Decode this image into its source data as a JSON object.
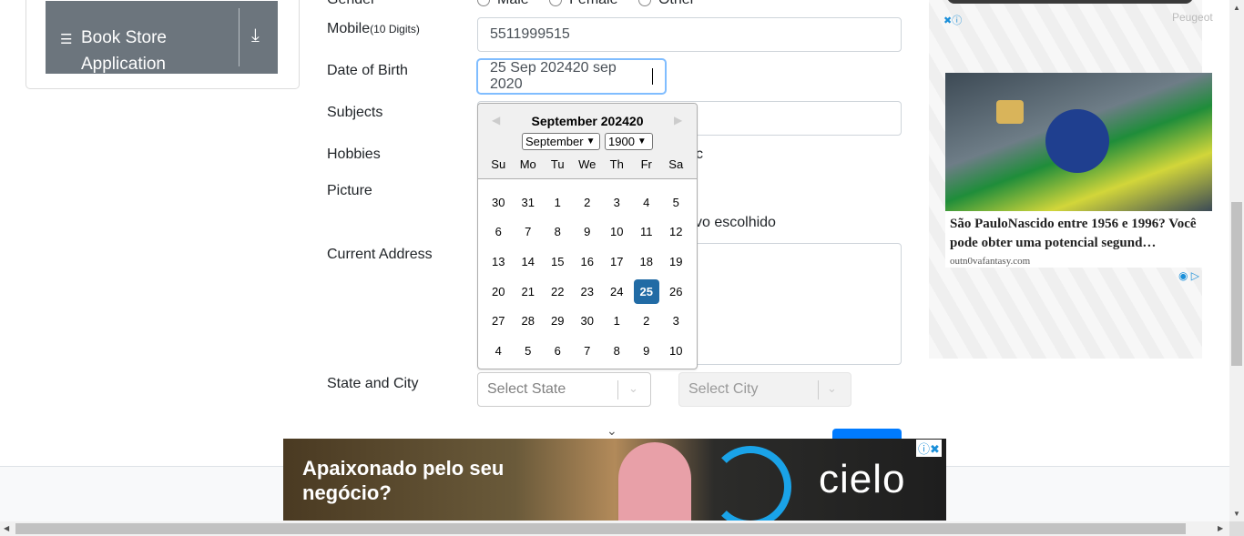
{
  "sidebar": {
    "item_label": "Book Store Application",
    "icon": "book-icon",
    "expand_icon": "download-arrow-icon"
  },
  "form": {
    "gender_label": "Gender",
    "gender_options": [
      "Male",
      "Female",
      "Other"
    ],
    "mobile_label": "Mobile",
    "mobile_hint": "(10 Digits)",
    "mobile_value": "5511999515",
    "dob_label": "Date of Birth",
    "dob_value": "25 Sep 202420 sep 2020",
    "subjects_label": "Subjects",
    "hobbies_label": "Hobbies",
    "hobbies_partial": "c",
    "picture_label": "Picture",
    "picture_status": "vo escolhido",
    "address_label": "Current Address",
    "state_city_label": "State and City",
    "state_placeholder": "Select State",
    "city_placeholder": "Select City"
  },
  "datepicker": {
    "title": "September 202420",
    "month_select": "September",
    "year_select": "1900",
    "weekdays": [
      "Su",
      "Mo",
      "Tu",
      "We",
      "Th",
      "Fr",
      "Sa"
    ],
    "weeks": [
      [
        "30",
        "31",
        "1",
        "2",
        "3",
        "4",
        "5"
      ],
      [
        "6",
        "7",
        "8",
        "9",
        "10",
        "11",
        "12"
      ],
      [
        "13",
        "14",
        "15",
        "16",
        "17",
        "18",
        "19"
      ],
      [
        "20",
        "21",
        "22",
        "23",
        "24",
        "25",
        "26"
      ],
      [
        "27",
        "28",
        "29",
        "30",
        "1",
        "2",
        "3"
      ],
      [
        "4",
        "5",
        "6",
        "7",
        "8",
        "9",
        "10"
      ]
    ],
    "selected_day": "25"
  },
  "ad_right": {
    "sponsor": "Peugeot",
    "headline": "São PauloNascido entre 1956 e 1996? Você pode obter uma potencial segund…",
    "domain": "outn0vafantasy.com"
  },
  "ad_bottom": {
    "headline": "Apaixonado pelo seu negócio?",
    "brand": "cielo"
  },
  "colors": {
    "sidebar_bg": "#6c757d",
    "selected_day": "#216ba5",
    "primary": "#007bff"
  }
}
